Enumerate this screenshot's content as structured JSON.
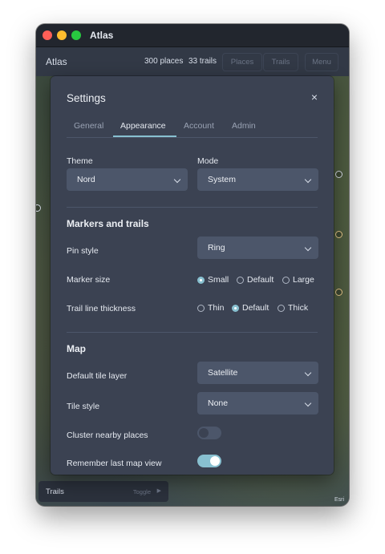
{
  "window": {
    "title": "Atlas"
  },
  "appbar": {
    "brand": "Atlas",
    "places": "300 places",
    "trails": "33 trails",
    "buttons": {
      "places": "Places",
      "trails": "Trails",
      "menu": "Menu"
    }
  },
  "map": {
    "attribution": "Esri"
  },
  "trails_panel": {
    "label": "Trails",
    "toggle": "Toggle"
  },
  "dialog": {
    "title": "Settings",
    "close": "×",
    "tabs": [
      "General",
      "Appearance",
      "Account",
      "Admin"
    ],
    "active_tab": "Appearance",
    "theme": {
      "label": "Theme",
      "value": "Nord"
    },
    "mode": {
      "label": "Mode",
      "value": "System"
    },
    "markers_section": "Markers and trails",
    "pin_style": {
      "label": "Pin style",
      "value": "Ring"
    },
    "marker_size": {
      "label": "Marker size",
      "options": [
        "Small",
        "Default",
        "Large"
      ],
      "selected": "Small"
    },
    "trail_thickness": {
      "label": "Trail line thickness",
      "options": [
        "Thin",
        "Default",
        "Thick"
      ],
      "selected": "Default"
    },
    "map_section": "Map",
    "tile_layer": {
      "label": "Default tile layer",
      "value": "Satellite"
    },
    "tile_style": {
      "label": "Tile style",
      "value": "None"
    },
    "cluster": {
      "label": "Cluster nearby places",
      "on": false
    },
    "remember": {
      "label": "Remember last map view",
      "on": true
    }
  },
  "colors": {
    "accent": "#88c0d0",
    "dialog_bg": "#3b4252",
    "control_bg": "#4c566a",
    "window_bg": "#2e3440"
  }
}
